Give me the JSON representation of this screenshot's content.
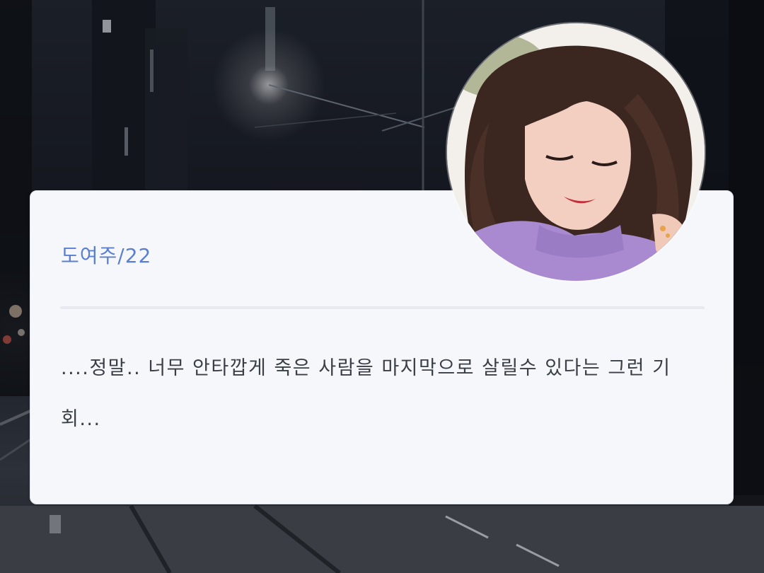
{
  "profile": {
    "name": "도여주/22",
    "accent_color": "#5a7fd0"
  },
  "dialogue": {
    "text": "....정말.. 너무 안타깝게 죽은 사람을 마지막으로 살릴수 있다는 그런 기회..."
  },
  "background": {
    "description_icon": "night-city-street-background"
  }
}
